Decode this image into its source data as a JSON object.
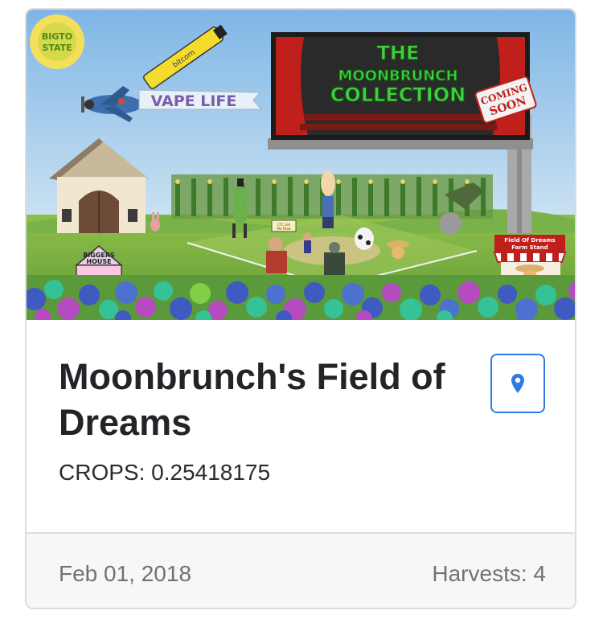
{
  "card": {
    "title": "Moonbrunch's Field of Dreams",
    "crops_label": "CROPS: 0.25418175",
    "date": "Feb 01, 2018",
    "harvests": "Harvests: 4",
    "map_button_icon": "map-pin-icon",
    "accent_color": "#2f7be3"
  },
  "image": {
    "sun_text_1": "BIGTO",
    "sun_text_2": "STATE",
    "vape_brand": "bitcorn",
    "banner_text": "VAPE LIFE",
    "billboard_line1": "THE",
    "billboard_line2": "MOONBRUNCH",
    "billboard_line3": "COLLECTION",
    "coming_soon_1": "COMING",
    "coming_soon_2": "SOON",
    "house_sign_1": "BIGGERS",
    "house_sign_2": "HOUSE",
    "stand_sign_1": "Field Of Dreams",
    "stand_sign_2": "Farm Stand",
    "ctc_sign_1": "CTC Get",
    "ctc_sign_2": "Me Pead"
  }
}
